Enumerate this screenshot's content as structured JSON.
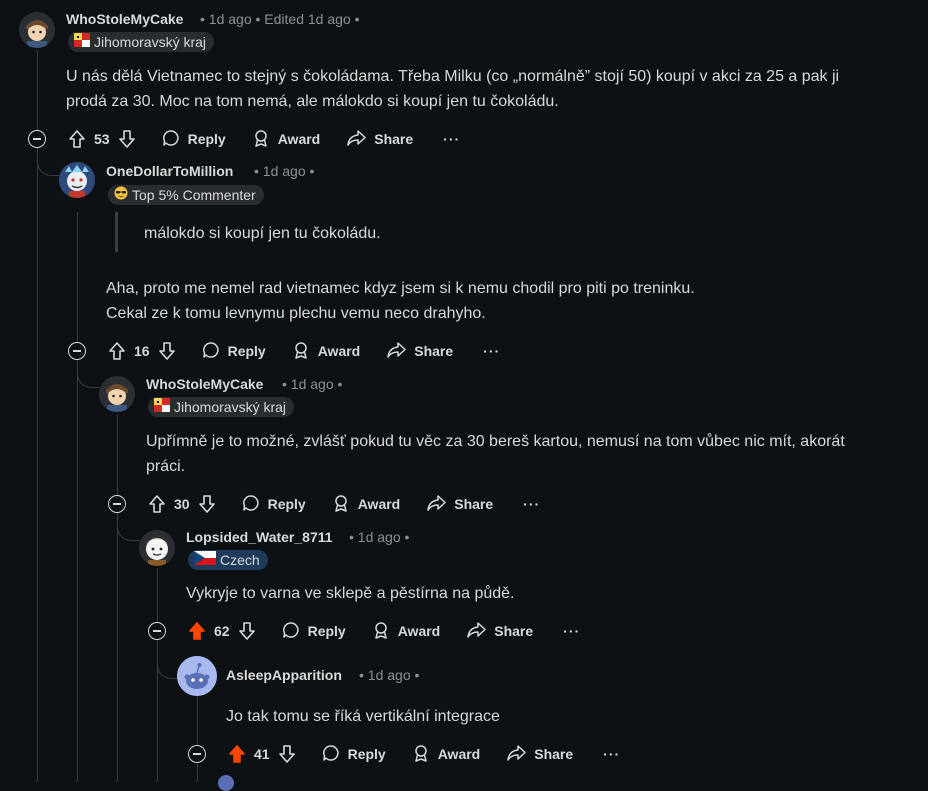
{
  "actions": {
    "reply": "Reply",
    "award": "Award",
    "share": "Share",
    "more": "···"
  },
  "comments": [
    {
      "author": "WhoStoleMyCake",
      "meta": "• 1d ago • Edited 1d ago •",
      "flair": "Jihomoravský kraj",
      "body": [
        "U nás dělá Vietnamec to stejný s čokoládama. Třeba Milku (co „normálně” stojí 50) koupí v akci za 25 a pak ji",
        "prodá za 30. Moc na tom nemá, ale málokdo si koupí jen tu čokoládu."
      ],
      "score": "53",
      "upvoted": false
    },
    {
      "author": "OneDollarToMillion",
      "meta": "• 1d ago •",
      "flair": "Top 5% Commenter",
      "quote": "málokdo si koupí jen tu čokoládu.",
      "body": [
        "Aha, proto me nemel rad vietnamec kdyz jsem si k nemu chodil pro piti po treninku.",
        "Cekal ze k tomu levnymu plechu vemu neco drahyho."
      ],
      "score": "16",
      "upvoted": false
    },
    {
      "author": "WhoStoleMyCake",
      "meta": "• 1d ago •",
      "flair": "Jihomoravský kraj",
      "body": [
        "Upřímně je to možné, zvlášť pokud tu věc za 30 bereš kartou, nemusí na tom vůbec nic mít, akorát",
        "práci."
      ],
      "score": "30",
      "upvoted": false
    },
    {
      "author": "Lopsided_Water_8711",
      "meta": "• 1d ago •",
      "flair": "Czech",
      "body": [
        "Vykryje to varna ve sklepě a pěstírna na půdě."
      ],
      "score": "62",
      "upvoted": true
    },
    {
      "author": "AsleepApparition",
      "meta": "• 1d ago •",
      "body": [
        "Jo tak tomu se říká vertikální integrace"
      ],
      "score": "41",
      "upvoted": true
    }
  ],
  "colors": {
    "background": "#0e1113",
    "text": "#d7dadc",
    "meta": "#8b9296",
    "thread_line": "#3a3d40",
    "upvote_active": "#ff4500",
    "flair_bg": "#2a2d30"
  }
}
